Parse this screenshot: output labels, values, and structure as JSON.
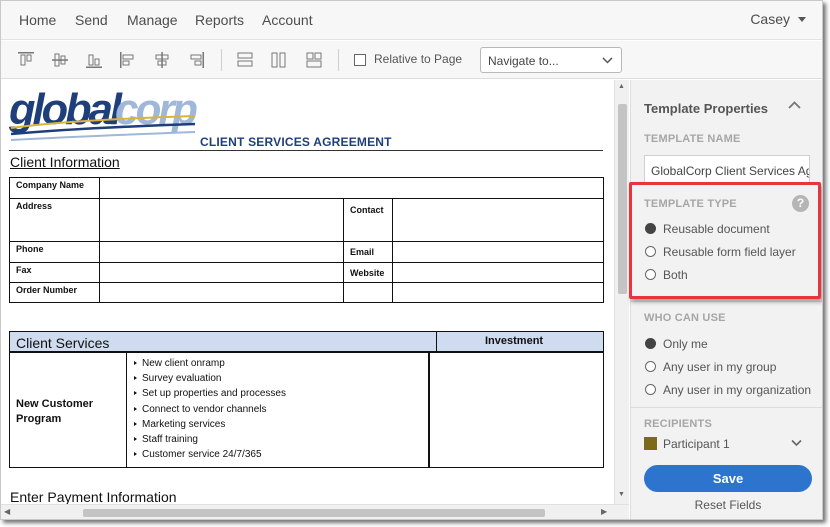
{
  "nav": {
    "items": [
      {
        "label": "Home"
      },
      {
        "label": "Send"
      },
      {
        "label": "Manage"
      },
      {
        "label": "Reports"
      },
      {
        "label": "Account"
      }
    ],
    "user": "Casey"
  },
  "toolbar": {
    "icons": [
      "align-top-icon",
      "align-middle-icon",
      "align-bottom-icon",
      "align-left-icon",
      "align-center-icon",
      "align-right-icon",
      "match-width-icon",
      "match-height-icon",
      "match-size-icon"
    ],
    "relative_label": "Relative to Page",
    "relative_checked": false,
    "navigate_value": "Navigate to..."
  },
  "document": {
    "logo_text": "globalcorp",
    "title": "CLIENT SERVICES AGREEMENT",
    "client_info_heading": "Client Information",
    "fields": {
      "company_name": "Company Name",
      "address": "Address",
      "contact": "Contact",
      "phone": "Phone",
      "email": "Email",
      "fax": "Fax",
      "website": "Website",
      "order_number": "Order Number"
    },
    "services": {
      "heading": "Client Services",
      "investment": "Investment",
      "program": "New Customer Program",
      "items": [
        "New client onramp",
        "Survey evaluation",
        "Set up properties and processes",
        "Connect to vendor channels",
        "Marketing services",
        "Staff training",
        "Customer service 24/7/365"
      ]
    },
    "payment_heading": "Enter Payment Information"
  },
  "panel": {
    "title": "Template Properties",
    "template_name_label": "TEMPLATE NAME",
    "template_name_value": "GlobalCorp Client Services Agreement",
    "template_type_label": "TEMPLATE TYPE",
    "help": "?",
    "template_types": [
      {
        "label": "Reusable document",
        "selected": true
      },
      {
        "label": "Reusable form field layer",
        "selected": false
      },
      {
        "label": "Both",
        "selected": false
      }
    ],
    "who_can_use_label": "WHO CAN USE",
    "who_can_use": [
      {
        "label": "Only me",
        "selected": true
      },
      {
        "label": "Any user in my group",
        "selected": false
      },
      {
        "label": "Any user in my organization",
        "selected": false
      }
    ],
    "recipients_label": "RECIPIENTS",
    "participant": "Participant 1",
    "participant_color": "#7a6a1a",
    "save_label": "Save",
    "reset_label": "Reset Fields"
  },
  "colors": {
    "accent": "#2d74cf",
    "highlight": "#e8343c",
    "service_header_bg": "#cfdbee",
    "title_blue": "#1f3f7a"
  }
}
